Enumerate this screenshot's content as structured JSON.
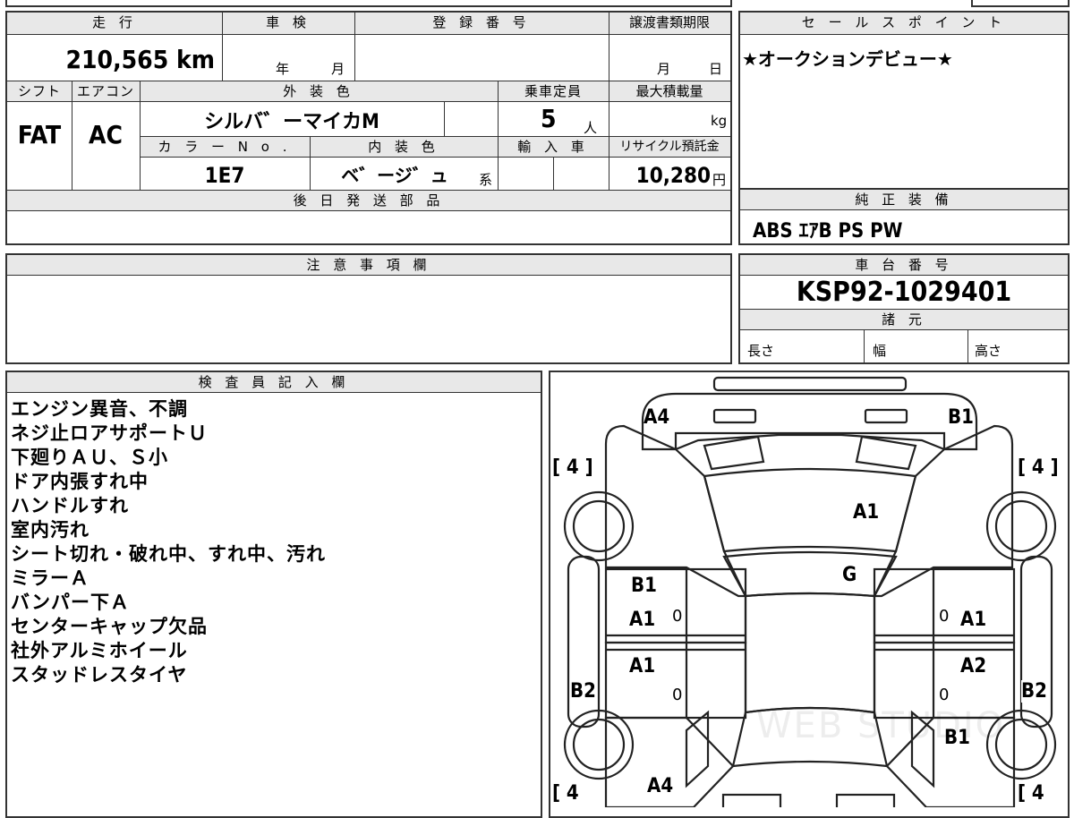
{
  "top_left": {
    "labels": {
      "mileage": "走 行",
      "inspection": "車 検",
      "registration": "登 録 番 号",
      "transfer_deadline": "譲渡書類期限",
      "shift": "シフト",
      "aircon": "エアコン",
      "exterior_color": "外 装 色",
      "capacity": "乗車定員",
      "max_load": "最大積載量",
      "color_no": "カ ラ ー N o .",
      "interior_color": "内 装 色",
      "import": "輸 入 車",
      "recycle": "リサイクル預託金"
    },
    "mileage_value": "210,565 km",
    "inspection_year_unit": "年",
    "inspection_month_unit": "月",
    "transfer_month_unit": "月",
    "transfer_day_unit": "日",
    "shift_value": "FAT",
    "aircon_value": "AC",
    "exterior_color_value": "シルバ゛ーマイカM",
    "capacity_value": "5",
    "capacity_unit": "人",
    "max_load_unit": "kg",
    "color_no_value": "1E7",
    "interior_color_value": "ベ゛ージ゛ュ",
    "interior_color_suffix": "系",
    "recycle_value": "10,280",
    "recycle_unit": "円"
  },
  "sales_point": {
    "header": "セ ー ル ス ポ イ ン ト",
    "text": "★オークションデビュー★"
  },
  "later_parts": {
    "header": "後 日 発 送 部 品"
  },
  "genuine_equipment": {
    "header": "純 正 装 備",
    "value": "ABS ｴｱB PS PW"
  },
  "caution": {
    "header": "注 意 事 項 欄"
  },
  "chassis": {
    "header": "車 台 番 号",
    "value": "KSP92-1029401"
  },
  "specs": {
    "header": "諸 元",
    "length": "長さ",
    "width": "幅",
    "height": "高さ"
  },
  "inspector": {
    "header": "検 査 員 記 入 欄",
    "notes": [
      "エンジン異音、不調",
      "ネジ止ロアサポートＵ",
      "下廻りＡＵ、Ｓ小",
      "ドア内張すれ中",
      "ハンドルすれ",
      "室内汚れ",
      "シート切れ・破れ中、すれ中、汚れ",
      "ミラーＡ",
      "バンパー下Ａ",
      "センターキャップ欠品",
      "社外アルミホイール",
      "スタッドレスタイヤ"
    ]
  },
  "diagram": {
    "tire_left_front": "[ 4 ]",
    "tire_right_front": "[ 4 ]",
    "tire_left_rear": "[ 4",
    "tire_right_rear": "[ 4",
    "front_left": "A4",
    "front_right": "B1",
    "hood": "A1",
    "windshield": "G",
    "left_front_door_1": "B1",
    "left_front_door_2": "A1",
    "left_front_door_zero": "0",
    "right_front_door": "A1",
    "right_front_door_zero": "0",
    "left_rear_door": "A1",
    "left_rear_door_zero": "0",
    "right_rear_door": "A2",
    "right_rear_door_zero": "0",
    "left_side": "B2",
    "right_side": "B2",
    "right_rear_fender": "B1",
    "rear_left": "A4",
    "watermark": "WEB STUDIO"
  }
}
